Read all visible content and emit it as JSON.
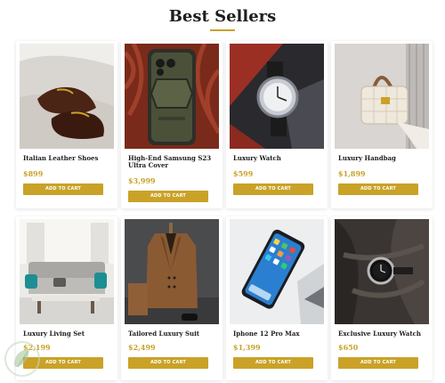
{
  "section": {
    "title": "Best Sellers"
  },
  "products": [
    {
      "name": "Italian Leather Shoes",
      "price": "$899",
      "button": "ADD TO CART",
      "image": "leather-shoes-photo"
    },
    {
      "name": "High-End Samsung S23 Ultra Cover",
      "price": "$3,999",
      "button": "ADD TO CART",
      "image": "phone-case-photo"
    },
    {
      "name": "Luxury Watch",
      "price": "$599",
      "button": "ADD TO CART",
      "image": "luxury-watch-photo"
    },
    {
      "name": "Luxury Handbag",
      "price": "$1,899",
      "button": "ADD TO CART",
      "image": "handbag-photo"
    },
    {
      "name": "Luxury Living Set",
      "price": "$2,199",
      "button": "ADD TO CART",
      "image": "living-room-photo"
    },
    {
      "name": "Tailored Luxury Suit",
      "price": "$2,499",
      "button": "ADD TO CART",
      "image": "suit-photo"
    },
    {
      "name": "Iphone 12 Pro Max",
      "price": "$1,399",
      "button": "ADD TO CART",
      "image": "iphone-photo"
    },
    {
      "name": "Exclusive Luxury Watch",
      "price": "$650",
      "button": "ADD TO CART",
      "image": "exclusive-watch-photo"
    }
  ],
  "colors": {
    "accent": "#c9a227",
    "title": "#1e1e1e",
    "card_bg": "#ffffff"
  }
}
